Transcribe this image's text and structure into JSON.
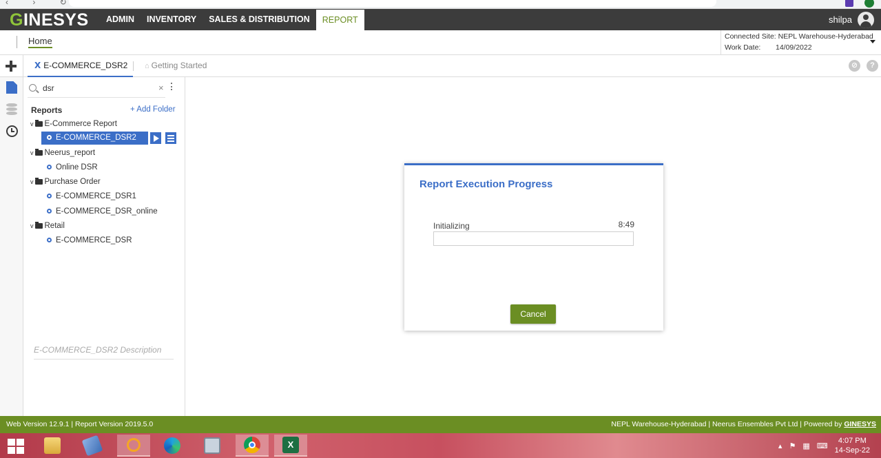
{
  "app": {
    "logo_prefix": "G",
    "logo_rest": "INESYS",
    "user": "shilpa"
  },
  "menu": [
    "ADMIN",
    "INVENTORY",
    "SALES & DISTRIBUTION",
    "REPORT"
  ],
  "breadcrumb": {
    "home": "Home"
  },
  "site": {
    "connected_label": "Connected Site:",
    "connected_value": "NEPL Warehouse-Hyderabad",
    "workdate_label": "Work Date:",
    "workdate_value": "14/09/2022"
  },
  "tabs": {
    "active": "E-COMMERCE_DSR2",
    "getting_started": "Getting Started"
  },
  "search": {
    "value": "dsr"
  },
  "tree": {
    "title": "Reports",
    "add_folder": "+ Add Folder",
    "folders": [
      {
        "name": "E-Commerce Report",
        "items": [
          "E-COMMERCE_DSR2"
        ]
      },
      {
        "name": "Neerus_report",
        "items": [
          "Online DSR"
        ]
      },
      {
        "name": "Purchase Order",
        "items": [
          "E-COMMERCE_DSR1",
          "E-COMMERCE_DSR_online"
        ]
      },
      {
        "name": "Retail",
        "items": [
          "E-COMMERCE_DSR"
        ]
      }
    ],
    "description_placeholder": "E-COMMERCE_DSR2 Description"
  },
  "dialog": {
    "title": "Report Execution Progress",
    "status": "Initializing",
    "time": "8:49",
    "progress": 0,
    "cancel": "Cancel"
  },
  "footer": {
    "left": "Web Version 12.9.1 | Report Version 2019.5.0",
    "right_prefix": "NEPL Warehouse-Hyderabad | Neerus Ensembles Pvt Ltd  |  Powered by ",
    "right_brand": "GINESYS"
  },
  "taskbar": {
    "time": "4:07 PM",
    "date": "14-Sep-22"
  },
  "colors": {
    "accent": "#3b6ec7",
    "brand_green": "#6b8e23",
    "nav_dark": "#3c3c3c"
  }
}
